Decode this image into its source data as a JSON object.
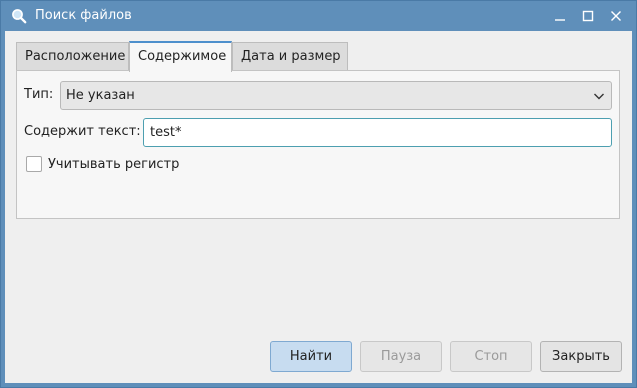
{
  "window": {
    "title": "Поиск файлов",
    "icon": "search-icon"
  },
  "title_buttons": [
    "minimize-icon",
    "maximize-icon",
    "close-icon"
  ],
  "tabs": [
    {
      "label": "Расположение",
      "active": false
    },
    {
      "label": "Содержимое",
      "active": true
    },
    {
      "label": "Дата и размер",
      "active": false
    }
  ],
  "content": {
    "type_label": "Тип:",
    "type_value": "Не указан",
    "text_label": "Содержит текст:",
    "text_value": "test*",
    "case_label": "Учитывать регистр",
    "case_checked": false
  },
  "buttons": {
    "find": "Найти",
    "pause": "Пауза",
    "stop": "Стоп",
    "close": "Закрыть"
  },
  "colors": {
    "titlebar": "#5f8fba",
    "accent": "#4d8fcc",
    "window_bg": "#efefef"
  }
}
